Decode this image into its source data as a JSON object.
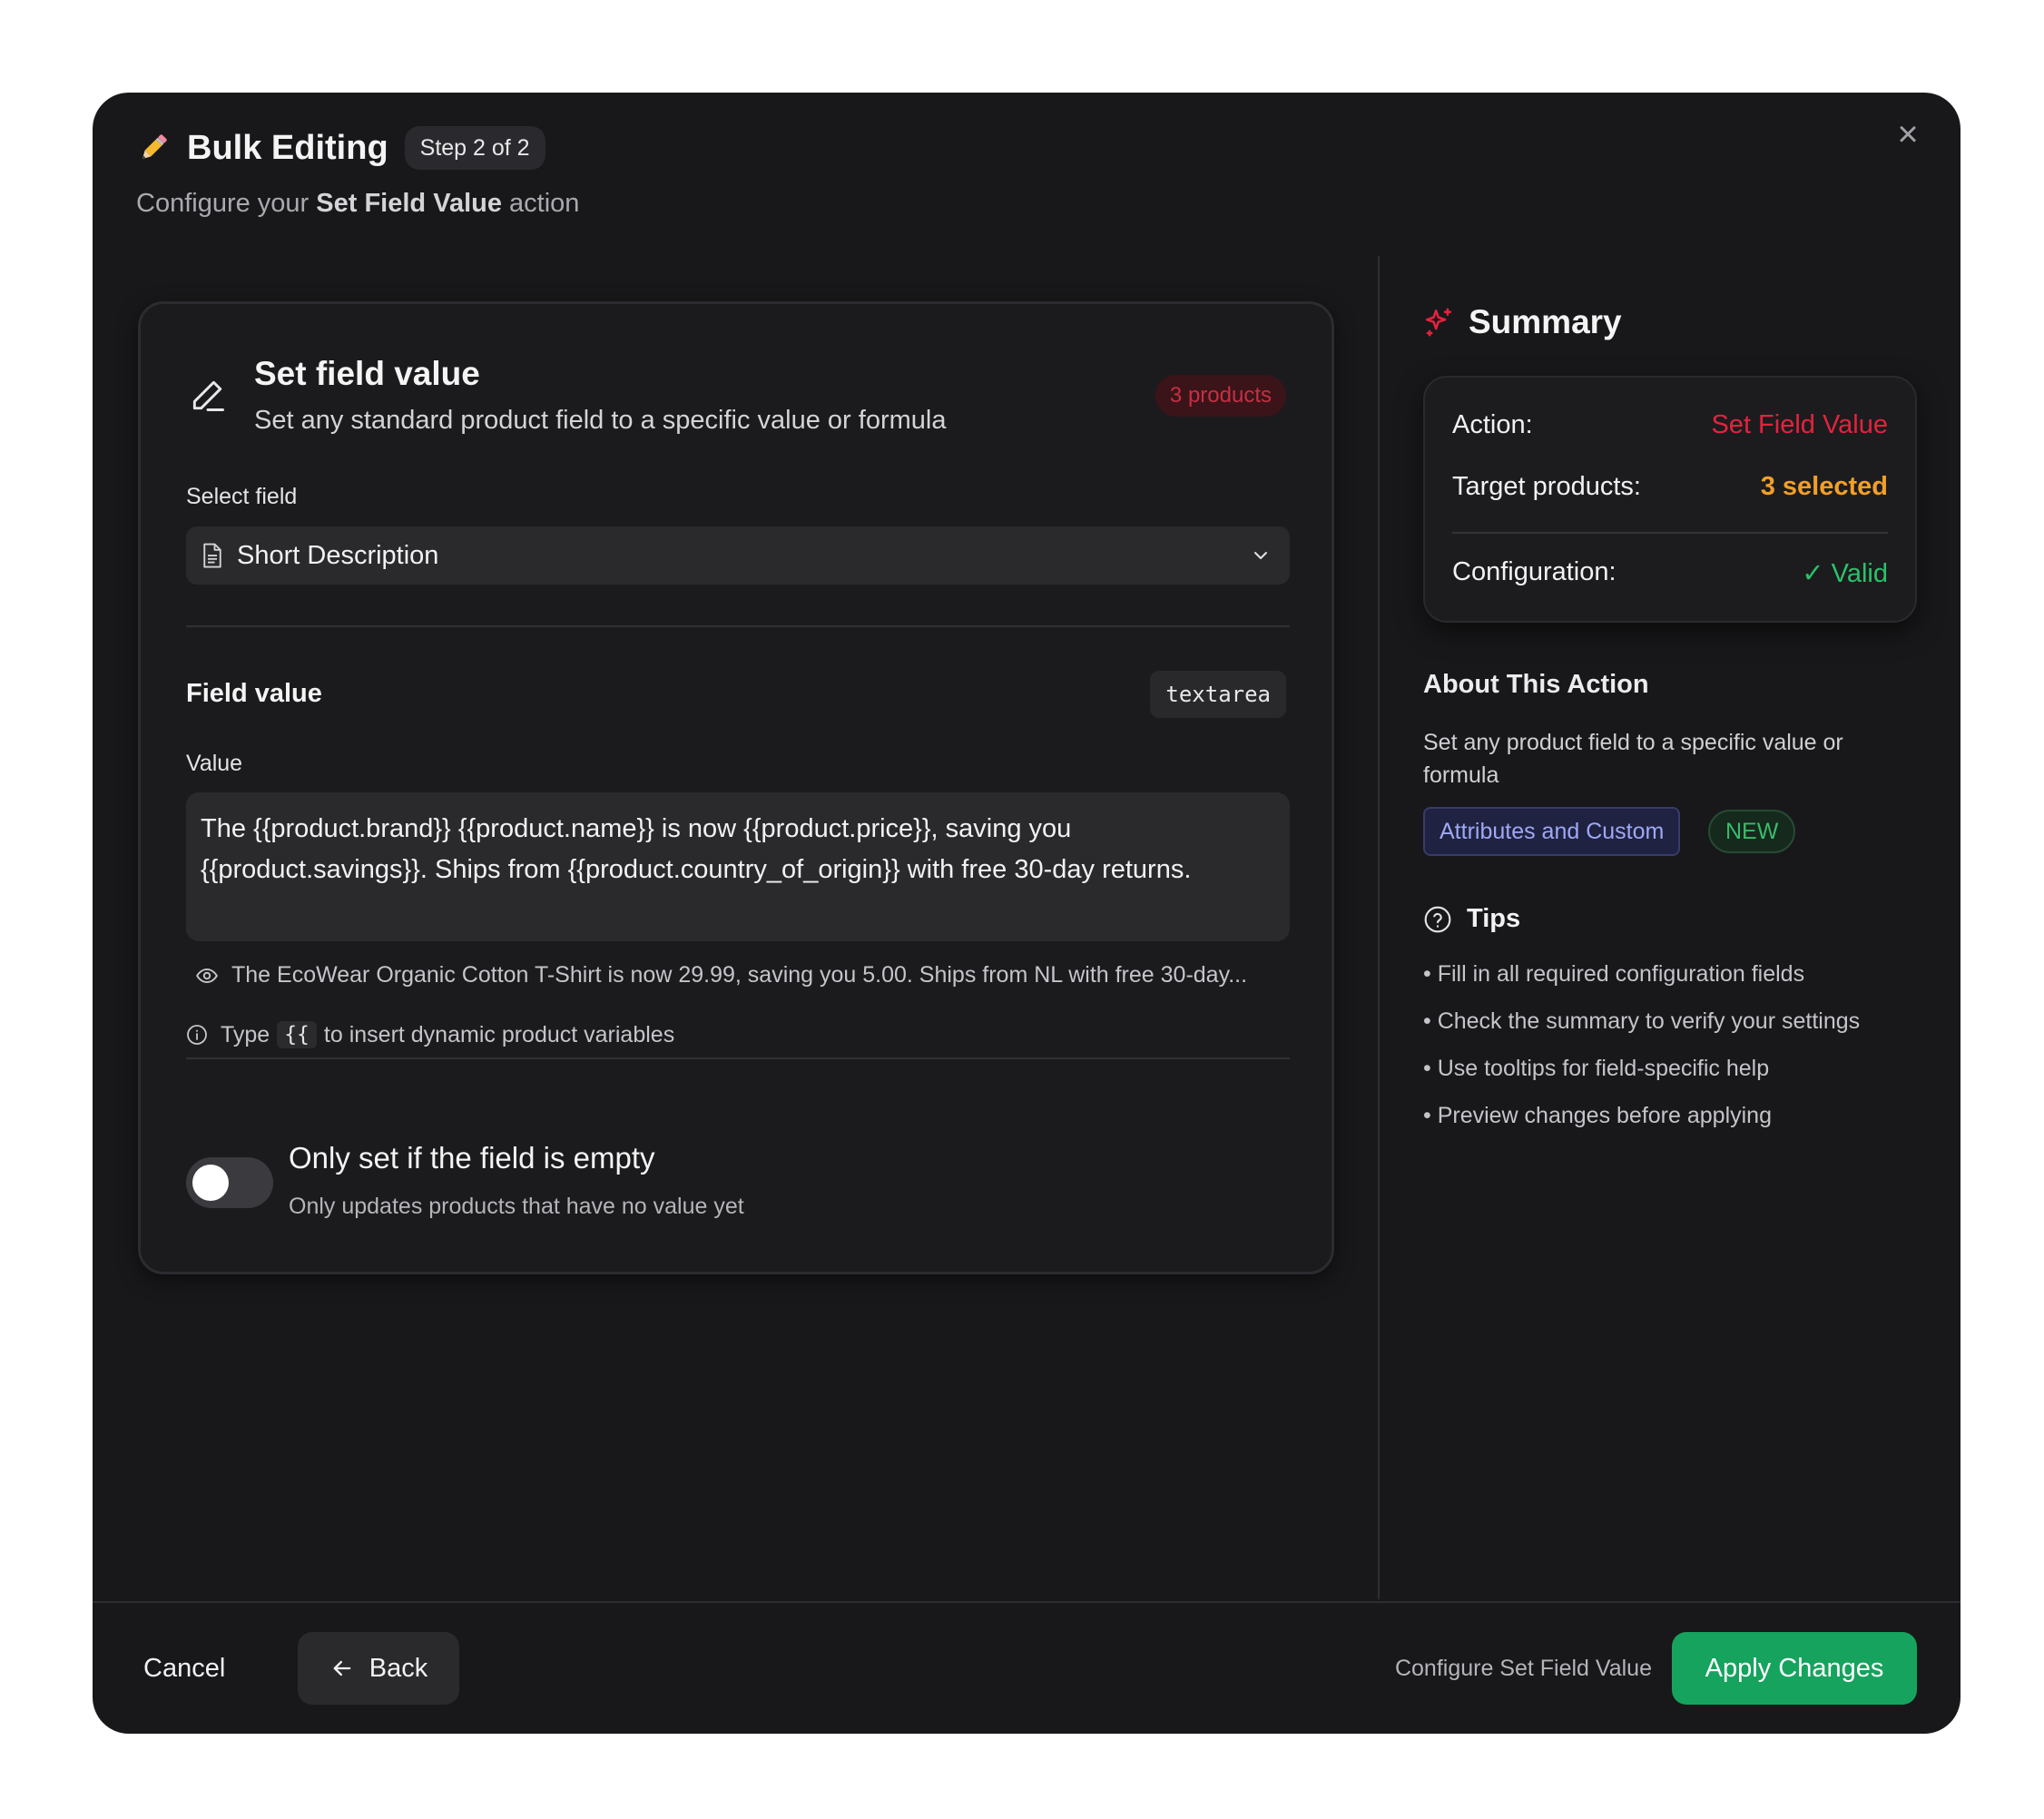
{
  "header": {
    "title": "Bulk Editing",
    "step_badge": "Step 2 of 2",
    "subtitle_prefix": "Configure your ",
    "subtitle_action": "Set Field Value",
    "subtitle_suffix": " action"
  },
  "action_card": {
    "title": "Set field value",
    "description": "Set any standard product field to a specific value or formula",
    "products_badge": "3 products",
    "select_label": "Select field",
    "selected_field": "Short Description",
    "field_value_title": "Field value",
    "field_type_tag": "textarea",
    "value_label": "Value",
    "value_line1": "The {{product.brand}} {{product.name}} is now {{product.price}}, saving you",
    "value_line2": "{{product.savings}}. Ships from {{product.country_of_origin}} with free 30-day returns.",
    "preview_text": "The EcoWear Organic Cotton T-Shirt is now 29.99, saving you 5.00. Ships from NL with free 30-day...",
    "hint_prefix": "Type",
    "hint_code": "{{",
    "hint_suffix": "to insert dynamic product variables",
    "toggle_title": "Only set if the field is empty",
    "toggle_subtitle": "Only updates products that have no value yet",
    "toggle_on": false
  },
  "summary": {
    "title": "Summary",
    "action_label": "Action:",
    "action_value": "Set Field Value",
    "target_label": "Target products:",
    "target_value": "3 selected",
    "config_label": "Configuration:",
    "config_value": "✓ Valid"
  },
  "about": {
    "title": "About This Action",
    "description": "Set any product field to a specific value or formula",
    "category_tag": "Attributes and Custom",
    "new_tag": "NEW"
  },
  "tips": {
    "title": "Tips",
    "items": [
      "• Fill in all required configuration fields",
      "• Check the summary to verify your settings",
      "• Use tooltips for field-specific help",
      "• Preview changes before applying"
    ]
  },
  "footer": {
    "cancel_label": "Cancel",
    "back_label": "Back",
    "status_text": "Configure Set Field Value",
    "apply_label": "Apply Changes"
  },
  "colors": {
    "modal_bg": "#18181a",
    "action_red": "#e5223e",
    "target_orange": "#f29f28",
    "valid_green": "#2bc26a",
    "apply_green": "#16a35e",
    "tag_purple": "#9fa8f5"
  },
  "icons": {
    "header": "pencil-emoji-icon",
    "close": "close-icon",
    "card": "edit-pencil-icon",
    "select_field": "document-icon",
    "select_open": "chevron-down-icon",
    "preview": "eye-icon",
    "hint": "info-icon",
    "summary": "sparkles-icon",
    "tips": "help-circle-icon",
    "back": "arrow-left-icon"
  }
}
